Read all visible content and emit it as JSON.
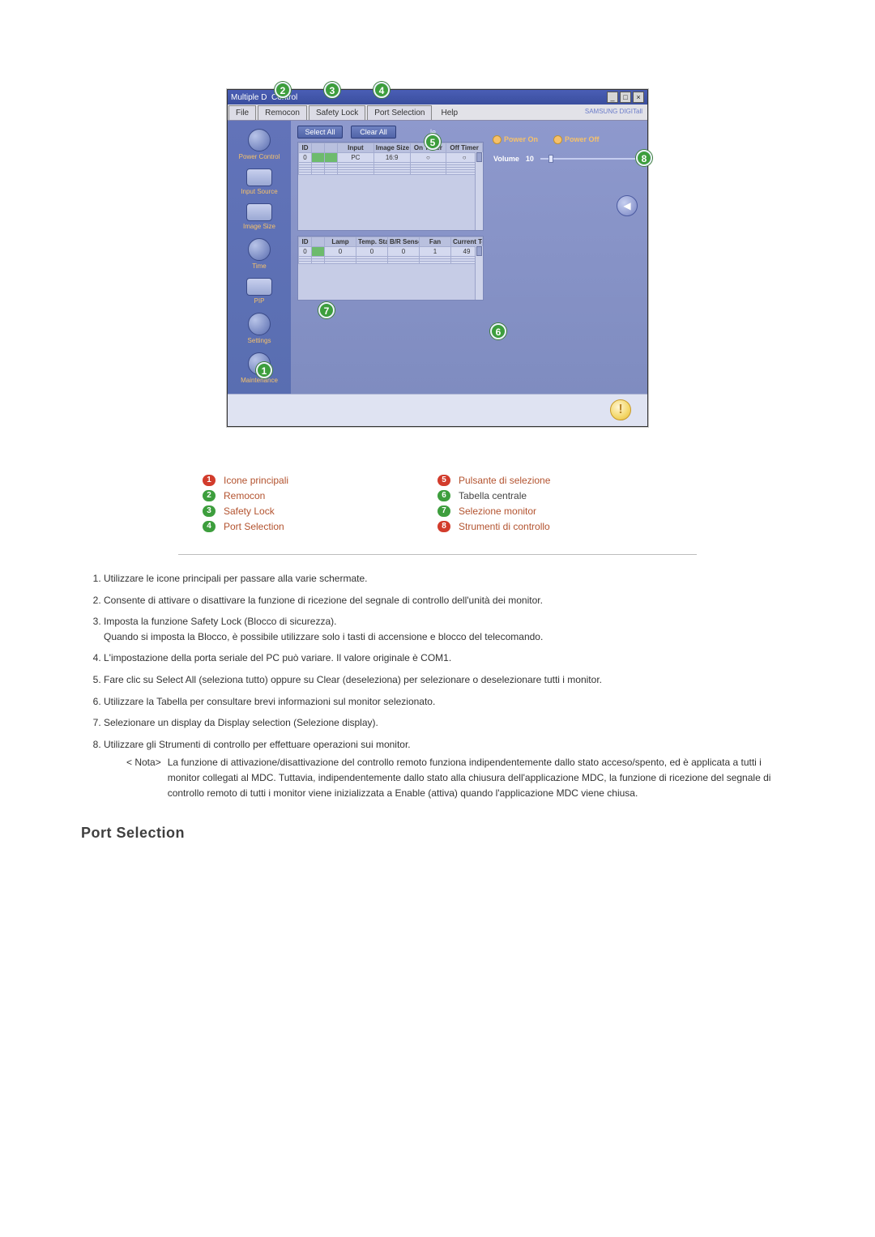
{
  "app": {
    "title_prefix": "Multiple D",
    "title_suffix": "Control",
    "brand": "SAMSUNG DIGITall",
    "menubar": {
      "file": "File",
      "remocon": "Remocon",
      "safety_lock": "Safety Lock",
      "port_selection": "Port Selection",
      "help": "Help"
    },
    "sidebar": {
      "power_control": "Power Control",
      "input_source": "Input Source",
      "image_size": "Image Size",
      "time": "Time",
      "pip": "PIP",
      "settings": "Settings",
      "maintenance": "Maintenance"
    },
    "selection": {
      "select_all": "Select All",
      "clear_all": "Clear All",
      "title_suffix": "le"
    },
    "grid_top": {
      "headers": [
        "ID",
        "",
        "",
        "Input",
        "Image Size",
        "On Timer",
        "Off Timer"
      ],
      "row": {
        "id": "0",
        "c2": "",
        "c3": "",
        "input": "PC",
        "image_size": "16:9",
        "on_timer": "○",
        "off_timer": "○"
      }
    },
    "grid_bottom": {
      "headers": [
        "ID",
        "",
        "Lamp",
        "Temp. Status",
        "B/R Sensor",
        "Fan",
        "Current Temp."
      ],
      "row": {
        "id": "0",
        "c2": "",
        "lamp": "0",
        "temp_status": "0",
        "br_sensor": "0",
        "fan": "1",
        "current_temp": "49"
      }
    },
    "controls": {
      "power_on": "Power On",
      "power_off": "Power Off",
      "volume_label": "Volume",
      "volume_value": "10"
    },
    "alert_glyph": "!",
    "speaker_glyph": "◀"
  },
  "callouts": {
    "c1": "1",
    "c2": "2",
    "c3": "3",
    "c4": "4",
    "c5": "5",
    "c6": "6",
    "c7": "7",
    "c8": "8"
  },
  "legend": {
    "l1": {
      "num": "1",
      "text": "Icone principali"
    },
    "l2": {
      "num": "2",
      "text": "Remocon"
    },
    "l3": {
      "num": "3",
      "text": "Safety Lock"
    },
    "l4": {
      "num": "4",
      "text": "Port Selection"
    },
    "l5": {
      "num": "5",
      "text": "Pulsante di selezione"
    },
    "l6": {
      "num": "6",
      "text": "Tabella centrale"
    },
    "l7": {
      "num": "7",
      "text": "Selezione monitor"
    },
    "l8": {
      "num": "8",
      "text": "Strumenti di controllo"
    }
  },
  "explain": {
    "i1": "Utilizzare le icone principali per passare alla varie schermate.",
    "i2": "Consente di attivare o disattivare la funzione di ricezione del segnale di controllo dell'unità dei monitor.",
    "i3a": "Imposta la funzione Safety Lock (Blocco di sicurezza).",
    "i3b": "Quando si imposta la Blocco, è possibile utilizzare solo i tasti di accensione e blocco del telecomando.",
    "i4": "L'impostazione della porta seriale del PC può variare. Il valore originale è COM1.",
    "i5": "Fare clic su Select All (seleziona tutto) oppure su Clear (deseleziona) per selezionare o deselezionare tutti i monitor.",
    "i6": "Utilizzare la Tabella per consultare brevi informazioni sul monitor selezionato.",
    "i7": "Selezionare un display da Display selection (Selezione display).",
    "i8": "Utilizzare gli Strumenti di controllo per effettuare operazioni sui monitor.",
    "note_tag": "< Nota>",
    "note_text": "La funzione di attivazione/disattivazione del controllo remoto funziona indipendentemente dallo stato acceso/spento, ed è applicata a tutti i monitor collegati al MDC. Tuttavia, indipendentemente dallo stato alla chiusura dell'applicazione MDC, la funzione di ricezione del segnale di controllo remoto di tutti i monitor viene inizializzata a Enable (attiva) quando l'applicazione MDC viene chiusa."
  },
  "section_heading": "Port Selection"
}
